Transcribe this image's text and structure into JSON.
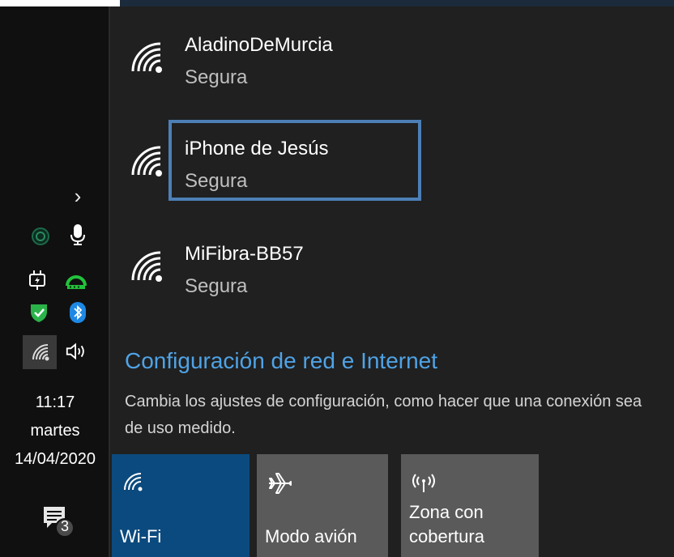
{
  "networks": [
    {
      "name": "AladinoDeMurcia",
      "status": "Segura"
    },
    {
      "name": "iPhone de Jesús",
      "status": "Segura"
    },
    {
      "name": "MiFibra-BB57",
      "status": "Segura"
    }
  ],
  "settings": {
    "link": "Configuración de red e Internet",
    "description": "Cambia los ajustes de configuración, como hacer que una conexión sea de uso medido."
  },
  "quick_actions": {
    "wifi": "Wi-Fi",
    "airplane": "Modo avión",
    "hotspot_line1": "Zona con",
    "hotspot_line2": "cobertura"
  },
  "taskbar": {
    "time": "11:17",
    "day": "martes",
    "date": "14/04/2020",
    "notification_count": "3"
  },
  "colors": {
    "accent": "#4fa3e6",
    "wifi_tile": "#0b4a7e",
    "highlight": "#4d7fb7",
    "defender_green": "#2bb34a",
    "bluetooth_blue": "#1e88e5"
  },
  "icons": {
    "tray": [
      "chevron-up-icon",
      "cortana-ring-icon",
      "microphone-icon",
      "power-plug-icon",
      "router-icon",
      "defender-shield-icon",
      "bluetooth-icon",
      "wifi-icon",
      "volume-icon",
      "action-center-icon"
    ]
  }
}
